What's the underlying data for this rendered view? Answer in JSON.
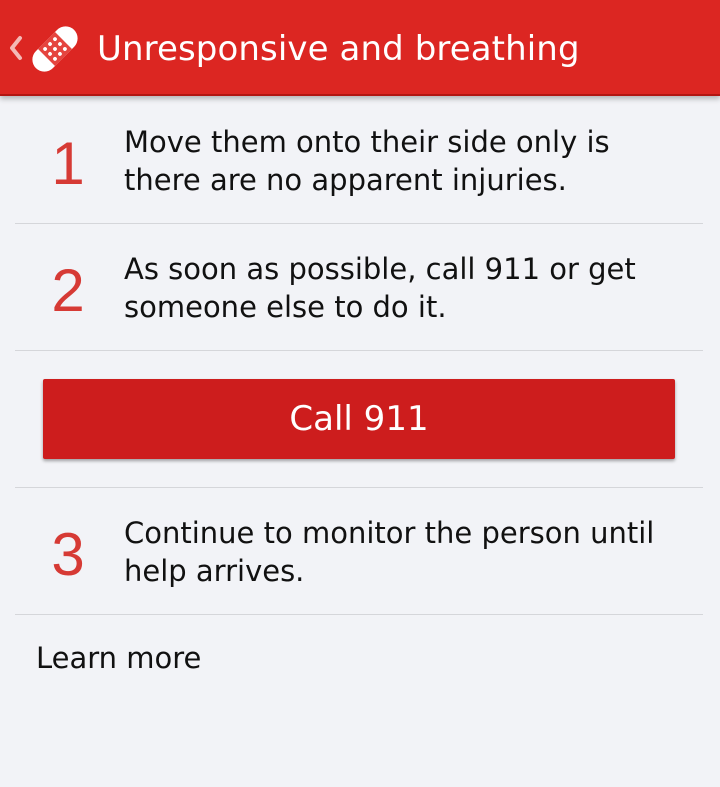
{
  "app_bar": {
    "title": "Unresponsive and breathing",
    "back_icon": "chevron-left-icon",
    "app_icon": "bandage-icon"
  },
  "steps": [
    {
      "number": "1",
      "text": "Move them onto their side only is there are no apparent injuries."
    },
    {
      "number": "2",
      "text": "As soon as possible, call 911 or get someone else to do it."
    },
    {
      "number": "3",
      "text": "Continue to monitor the person until help arrives."
    }
  ],
  "call_button": {
    "label": "Call 911"
  },
  "learn_more": {
    "label": "Learn more"
  },
  "colors": {
    "app_bar": "#dc2622",
    "accent_number": "#d63a35",
    "button": "#cd1d1d",
    "background": "#f2f3f7"
  }
}
